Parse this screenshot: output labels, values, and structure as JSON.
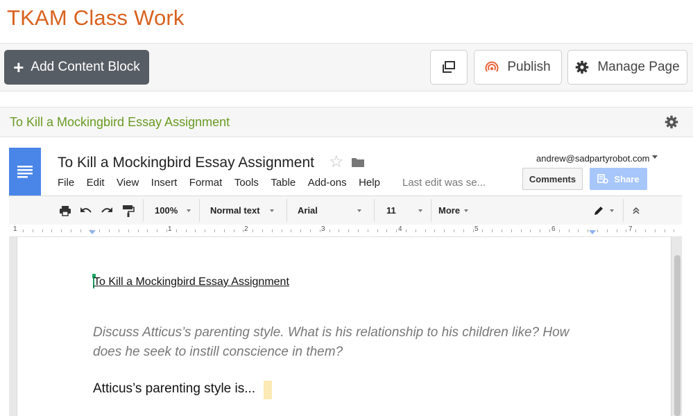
{
  "site": {
    "title": "TKAM Class Work"
  },
  "topbar": {
    "add_label": "Add Content Block",
    "publish_label": "Publish",
    "manage_label": "Manage Page"
  },
  "block": {
    "title": "To Kill a Mockingbird Essay Assignment"
  },
  "doc": {
    "title": "To Kill a Mockingbird Essay Assignment",
    "menu": [
      "File",
      "Edit",
      "View",
      "Insert",
      "Format",
      "Tools",
      "Table",
      "Add-ons",
      "Help"
    ],
    "last_edit": "Last edit was se...",
    "account": "andrew@sadpartyrobot.com",
    "comments_label": "Comments",
    "share_label": "Share"
  },
  "toolbar": {
    "zoom": "100%",
    "style": "Normal text",
    "font": "Arial",
    "size": "11",
    "more": "More"
  },
  "ruler": {
    "labels": [
      "1",
      "1",
      "2",
      "3",
      "4",
      "5",
      "6",
      "7"
    ]
  },
  "content": {
    "heading": "To Kill a Mockingbird Essay Assignment",
    "prompt": "Discuss Atticus’s parenting style. What is his relationship to his children like? How does he seek to instill conscience in them?",
    "answer": "Atticus’s parenting style is..."
  },
  "colors": {
    "site_title": "#d9621f",
    "block_title": "#6a9a23",
    "docs_blue": "#4a86e8",
    "share_button": "#a7c6fa",
    "add_button": "#575d64"
  }
}
